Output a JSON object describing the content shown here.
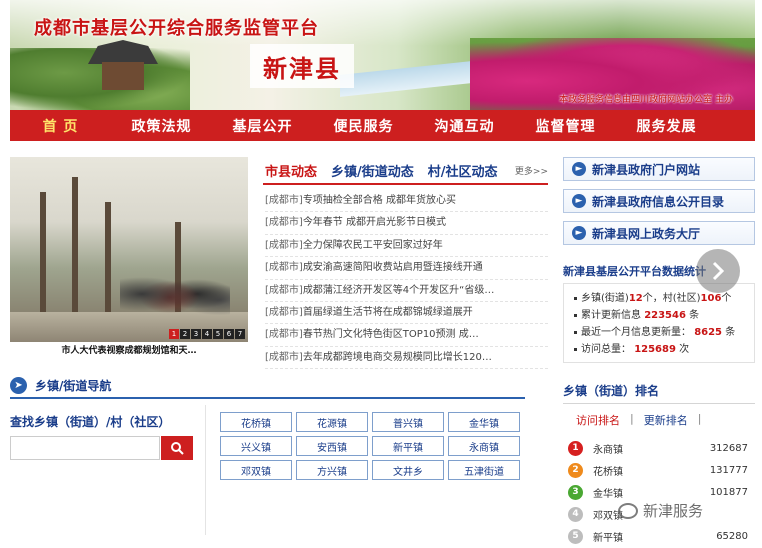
{
  "header": {
    "site_title": "成都市基层公开综合服务监管平台",
    "county": "新津县",
    "credit": "本政务服务信息由四川政府网站办公室 主办"
  },
  "nav": {
    "items": [
      {
        "label": "首 页",
        "active": true
      },
      {
        "label": "政策法规",
        "active": false
      },
      {
        "label": "基层公开",
        "active": false
      },
      {
        "label": "便民服务",
        "active": false
      },
      {
        "label": "沟通互动",
        "active": false
      },
      {
        "label": "监督管理",
        "active": false
      },
      {
        "label": "服务发展",
        "active": false
      }
    ]
  },
  "photo": {
    "caption": "市人大代表视察成都规划馆和天…",
    "pager": [
      "1",
      "2",
      "3",
      "4",
      "5",
      "6",
      "7"
    ]
  },
  "news": {
    "tabs": [
      {
        "label": "市县动态",
        "active": true
      },
      {
        "label": "乡镇/街道动态",
        "active": false
      },
      {
        "label": "村/社区动态",
        "active": false
      }
    ],
    "more": "更多>>",
    "items": [
      {
        "source": "[成都市]",
        "title": "专项抽检全部合格 成都年货放心买"
      },
      {
        "source": "[成都市]",
        "title": "今年春节 成都开启光影节日模式"
      },
      {
        "source": "[成都市]",
        "title": "全力保障农民工平安回家过好年"
      },
      {
        "source": "[成都市]",
        "title": "成安渝高速简阳收费站启用暨连接线开通"
      },
      {
        "source": "[成都市]",
        "title": "成都蒲江经济开发区等4个开发区升“省级…"
      },
      {
        "source": "[成都市]",
        "title": "首届绿道生活节将在成都锦城绿道展开"
      },
      {
        "source": "[成都市]",
        "title": "春节热门文化特色街区TOP10预测 成…"
      },
      {
        "source": "[成都市]",
        "title": "去年成都跨境电商交易规模同比增长120…"
      }
    ]
  },
  "links": [
    {
      "label": "新津县政府门户网站"
    },
    {
      "label": "新津县政府信息公开目录"
    },
    {
      "label": "新津县网上政务大厅"
    }
  ],
  "stats": {
    "title": "新津县基层公开平台数据统计",
    "town_prefix": "乡镇(街道)",
    "town_count": "12",
    "town_mid": "个，村(社区)",
    "village_count": "106",
    "village_unit": "个",
    "total_label": "累计更新信息",
    "total_value": "223546",
    "total_unit": "条",
    "month_label": "最近一个月信息更新量：",
    "month_value": "8625",
    "month_unit": "条",
    "visits_label": "访问总量：",
    "visits_value": "125689",
    "visits_unit": "次"
  },
  "township": {
    "title": "乡镇/街道导航",
    "search_title": "查找乡镇（街道）/村（社区）",
    "search_placeholder": "",
    "towns": [
      "花桥镇",
      "花源镇",
      "普兴镇",
      "金华镇",
      "兴义镇",
      "安西镇",
      "新平镇",
      "永商镇",
      "邓双镇",
      "方兴镇",
      "文井乡",
      "五津街道"
    ]
  },
  "rank": {
    "title": "乡镇（街道）排名",
    "tabs": [
      {
        "label": "访问排名",
        "active": true
      },
      {
        "label": "更新排名",
        "active": false
      }
    ],
    "items": [
      {
        "num": "1",
        "name": "永商镇",
        "value": "312687",
        "color": "#d62020"
      },
      {
        "num": "2",
        "name": "花桥镇",
        "value": "131777",
        "color": "#ef8a1c"
      },
      {
        "num": "3",
        "name": "金华镇",
        "value": "101877",
        "color": "#4aa833"
      },
      {
        "num": "4",
        "name": "邓双镇",
        "value": "",
        "color": "#bdbdbd"
      },
      {
        "num": "5",
        "name": "新平镇",
        "value": "65280",
        "color": "#bdbdbd"
      }
    ]
  },
  "watermark": {
    "text": "新津服务"
  },
  "colors": {
    "brand_red": "#cd1f1f",
    "link_blue": "#1a3d8a",
    "accent_blue": "#2b61ae"
  }
}
